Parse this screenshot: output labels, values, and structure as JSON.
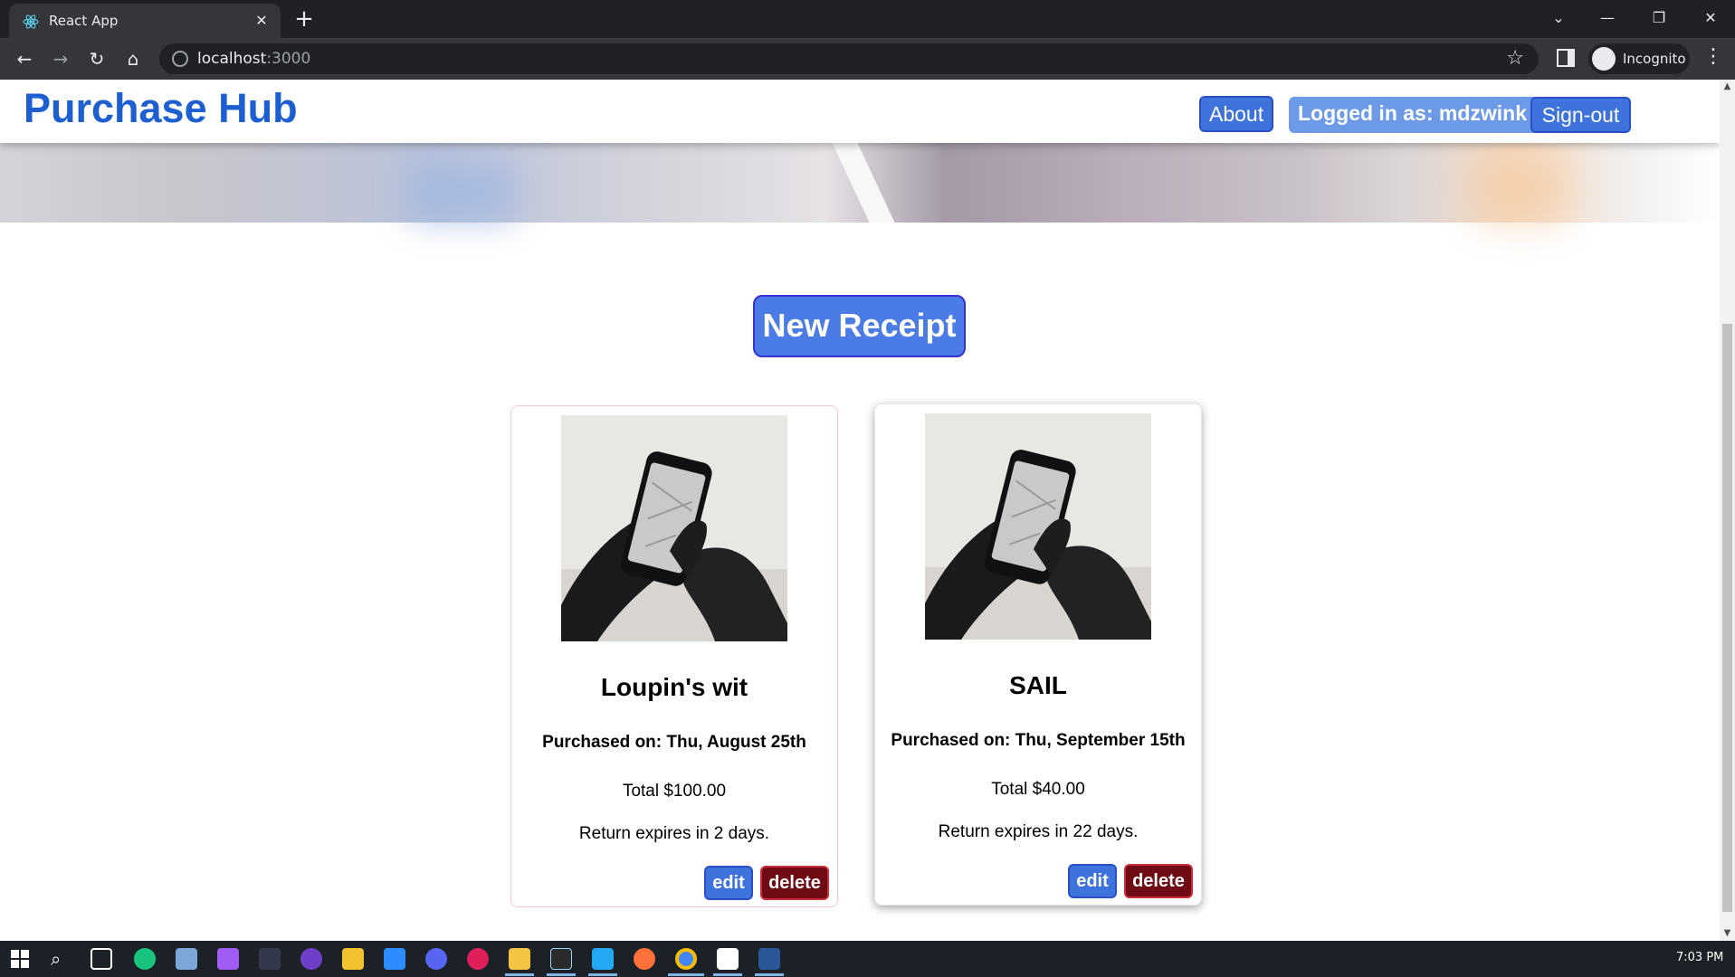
{
  "browser": {
    "tab_title": "React App",
    "url_host": "localhost",
    "url_port": ":3000",
    "profile_label": "Incognito",
    "icons": [
      "react-icon",
      "close-icon",
      "plus-icon",
      "back-icon",
      "forward-icon",
      "reload-icon",
      "home-icon",
      "info-icon",
      "star-icon",
      "sidepanel-icon",
      "incognito-icon",
      "kebab-menu-icon"
    ]
  },
  "navbar": {
    "brand": "Purchase Hub",
    "about_label": "About",
    "logged_in_text": "Logged in as: mdzwink",
    "signout_label": "Sign-out"
  },
  "main": {
    "new_receipt_label": "New Receipt",
    "receipts": [
      {
        "title": "Loupin's wit",
        "purchased": "Purchased on: Thu, August 25th",
        "total": "Total $100.00",
        "return_text": "Return expires in 2 days.",
        "edit_label": "edit",
        "delete_label": "delete"
      },
      {
        "title": "SAIL",
        "purchased": "Purchased on: Thu, September 15th",
        "total": "Total $40.00",
        "return_text": "Return expires in 22 days.",
        "edit_label": "edit",
        "delete_label": "delete"
      }
    ]
  },
  "taskbar": {
    "clock": "7:03 PM"
  },
  "colors": {
    "brand": "#1d5fd1",
    "primary_button": "#3f73dc",
    "danger_button": "#6e0b14",
    "chrome_dark": "#202124"
  }
}
